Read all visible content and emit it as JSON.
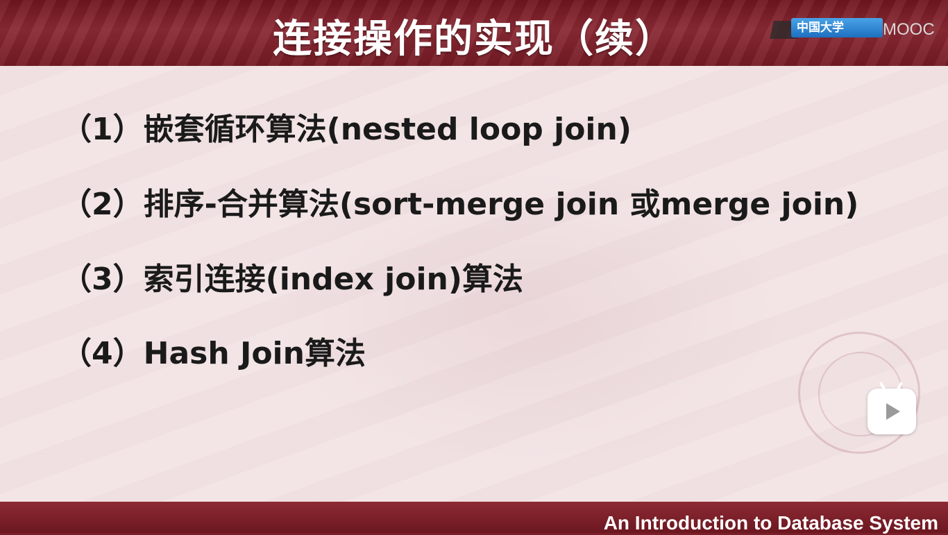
{
  "slide": {
    "title": "连接操作的实现（续）",
    "logo_text": "中国大学",
    "logo_suffix": "MOOC",
    "items": [
      "（1）嵌套循环算法(nested loop join)",
      "（2）排序-合并算法(sort-merge join 或merge join)",
      "（3）索引连接(index join)算法",
      "（4）Hash Join算法"
    ],
    "footer": "An Introduction to Database System"
  },
  "colors": {
    "header_bg": "#7a1e28",
    "content_bg": "#f3e5e6",
    "text": "#1a1a1a",
    "title_text": "#ffffff"
  },
  "icons": {
    "play_button": "play-icon"
  }
}
